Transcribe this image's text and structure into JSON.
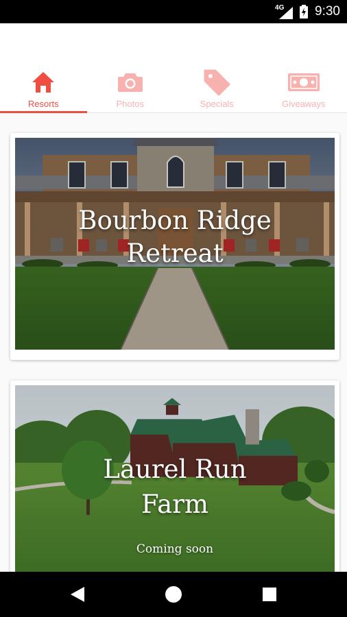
{
  "status_bar": {
    "network": "4G",
    "time": "9:30",
    "icons": [
      "signal-icon",
      "battery-charging-icon"
    ]
  },
  "tabs": [
    {
      "label": "Resorts",
      "icon": "home-icon",
      "active": true
    },
    {
      "label": "Photos",
      "icon": "camera-icon",
      "active": false
    },
    {
      "label": "Specials",
      "icon": "tag-icon",
      "active": false
    },
    {
      "label": "Giveaways",
      "icon": "dollar-bill-icon",
      "active": false
    }
  ],
  "cards": [
    {
      "title_line1": "Bourbon Ridge",
      "title_line2": "Retreat",
      "subtitle": ""
    },
    {
      "title_line1": "Laurel Run",
      "title_line2": "Farm",
      "subtitle": "Coming soon"
    }
  ],
  "nav_bar": {
    "icons": [
      "back-icon",
      "home-circle-icon",
      "recents-icon"
    ]
  },
  "colors": {
    "accent": "#f04e43",
    "accent_light": "#f7b2b0",
    "statusbar": "#000000"
  }
}
